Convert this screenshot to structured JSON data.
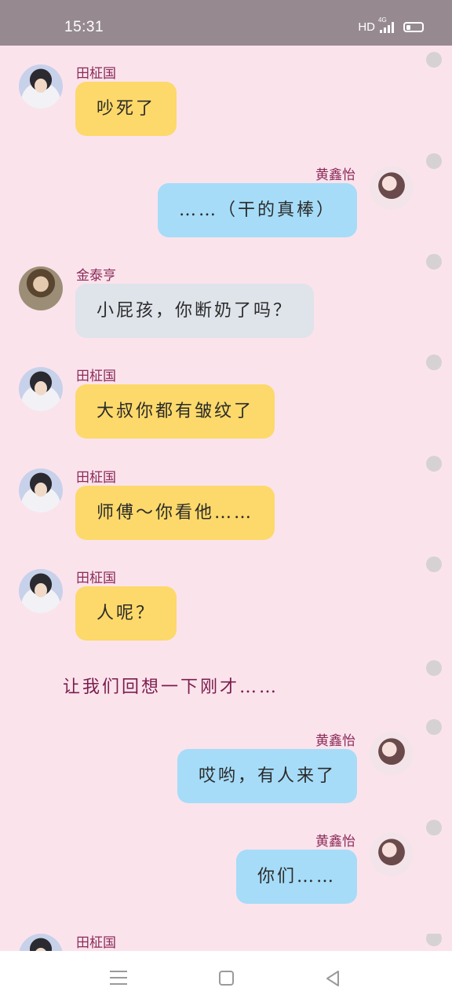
{
  "status_bar": {
    "time": "15:31",
    "network": "HD",
    "signal_label": "4G"
  },
  "messages": [
    {
      "sender": "田柾国",
      "text": "吵死了",
      "side": "left",
      "avatar": "jungkook-avatar",
      "bubble_color": "#fcd96a"
    },
    {
      "sender": "黄鑫怡",
      "text": "……（干的真棒）",
      "side": "right",
      "avatar": "xinyi-avatar",
      "bubble_color": "#a6dcf8"
    },
    {
      "sender": "金泰亨",
      "text": "小屁孩，你断奶了吗？",
      "side": "left",
      "avatar": "taehyung-avatar",
      "bubble_color": "#dfe3ea"
    },
    {
      "sender": "田柾国",
      "text": "大叔你都有皱纹了",
      "side": "left",
      "avatar": "jungkook-avatar",
      "bubble_color": "#fcd96a"
    },
    {
      "sender": "田柾国",
      "text": "师傅～你看他……",
      "side": "left",
      "avatar": "jungkook-avatar",
      "bubble_color": "#fcd96a"
    },
    {
      "sender": "田柾国",
      "text": "人呢？",
      "side": "left",
      "avatar": "jungkook-avatar",
      "bubble_color": "#fcd96a"
    },
    {
      "sender": "黄鑫怡",
      "text": "哎哟，有人来了",
      "side": "right",
      "avatar": "xinyi-avatar",
      "bubble_color": "#a6dcf8"
    },
    {
      "sender": "黄鑫怡",
      "text": "你们……",
      "side": "right",
      "avatar": "xinyi-avatar",
      "bubble_color": "#a6dcf8"
    },
    {
      "sender": "田柾国",
      "text": "",
      "side": "left",
      "avatar": "jungkook-avatar",
      "bubble_color": "#fcd96a"
    }
  ],
  "narration": "让我们回想一下刚才……",
  "nav": {
    "menu_icon": "menu-icon",
    "home_icon": "home-icon",
    "back_icon": "back-icon"
  }
}
